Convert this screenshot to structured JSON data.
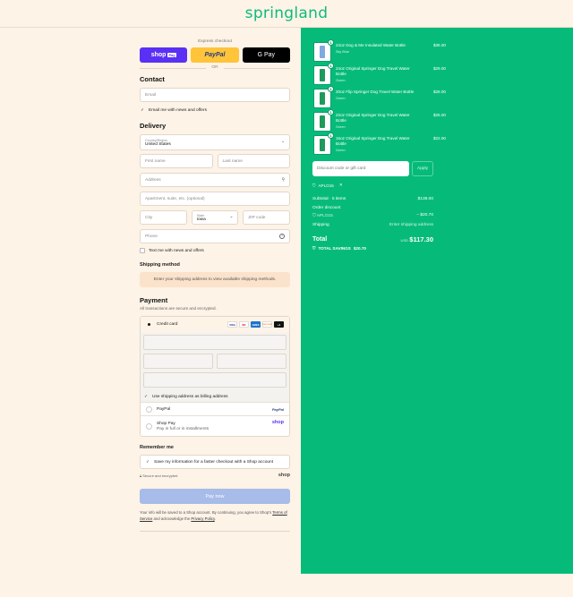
{
  "brand": {
    "name": "springland"
  },
  "express": {
    "label": "Express checkout",
    "shop_label": "shop",
    "shop_tag": "Pay",
    "paypal_label": "PayPal",
    "gpay_label": "G Pay",
    "or_label": "OR"
  },
  "contact": {
    "title": "Contact",
    "email_placeholder": "Email",
    "newsletter_label": "Email me with news and offers"
  },
  "delivery": {
    "title": "Delivery",
    "country_label": "Country/Region",
    "country_value": "United States",
    "first_name_placeholder": "First name",
    "last_name_placeholder": "Last name",
    "address_placeholder": "Address",
    "apartment_placeholder": "Apartment, suite, etc. (optional)",
    "city_placeholder": "City",
    "state_label": "State",
    "state_value": "Iowa",
    "zip_placeholder": "ZIP code",
    "phone_placeholder": "Phone",
    "text_label": "Text me with news and offers"
  },
  "shipping": {
    "title": "Shipping method",
    "info": "Enter your shipping address to view available shipping methods."
  },
  "payment": {
    "title": "Payment",
    "subtitle": "All transactions are secure and encrypted.",
    "credit_card_label": "Credit card",
    "card_logos": [
      "VISA",
      "MC",
      "AMEX",
      "DISCOVER",
      "+4"
    ],
    "billing_label": "Use shipping address as billing address",
    "paypal_label": "PayPal",
    "paypal_logo": "PayPal",
    "shoppay_label": "Shop Pay",
    "shoppay_sub": "Pay in full or in installments",
    "shoppay_logo": "shop"
  },
  "remember": {
    "title": "Remember me",
    "save_label": "Save my information for a faster checkout with a Shop account",
    "secure_label": "Secure and encrypted",
    "shop_logo": "shop"
  },
  "pay_now": {
    "label": "Pay now"
  },
  "legal": {
    "text": "Your info will be saved to a Shop account. By continuing, you agree to Shop's",
    "terms": "Terms of Service",
    "and": "and acknowledge the",
    "privacy": "Privacy Policy",
    "end": "."
  },
  "cart": {
    "items": [
      {
        "qty": "1",
        "name": "24oz Dog & Me Insulated Water Bottle",
        "variant": "Sky Blue",
        "price": "$36.00",
        "color": "#7fa9e0"
      },
      {
        "qty": "1",
        "name": "24oz Original Springer Dog Travel Water Bottle",
        "variant": "Green",
        "price": "$29.00",
        "color": "#1f9a5c"
      },
      {
        "qty": "1",
        "name": "20oz Flip Springer Dog Travel Water Bottle",
        "variant": "Green",
        "price": "$28.00",
        "color": "#1f9a5c"
      },
      {
        "qty": "1",
        "name": "22oz Original Springer Dog Travel Water Bottle",
        "variant": "Green",
        "price": "$25.00",
        "color": "#1f9a5c"
      },
      {
        "qty": "1",
        "name": "15oz Original Springer Dog Travel Water Bottle",
        "variant": "Green",
        "price": "$22.00",
        "color": "#1f9a5c"
      }
    ],
    "discount_placeholder": "Discount code or gift card",
    "apply_label": "Apply",
    "applied_code": "APLO15",
    "subtotal_label": "Subtotal · 5 items",
    "subtotal_value": "$138.00",
    "order_discount_label": "Order discount",
    "discount_code": "APLO15",
    "discount_value": "– $20.70",
    "shipping_label": "Shipping",
    "shipping_value": "Enter shipping address",
    "total_label": "Total",
    "currency": "USD",
    "total_value": "$117.30",
    "savings_label": "TOTAL SAVINGS",
    "savings_value": "$20.70"
  }
}
